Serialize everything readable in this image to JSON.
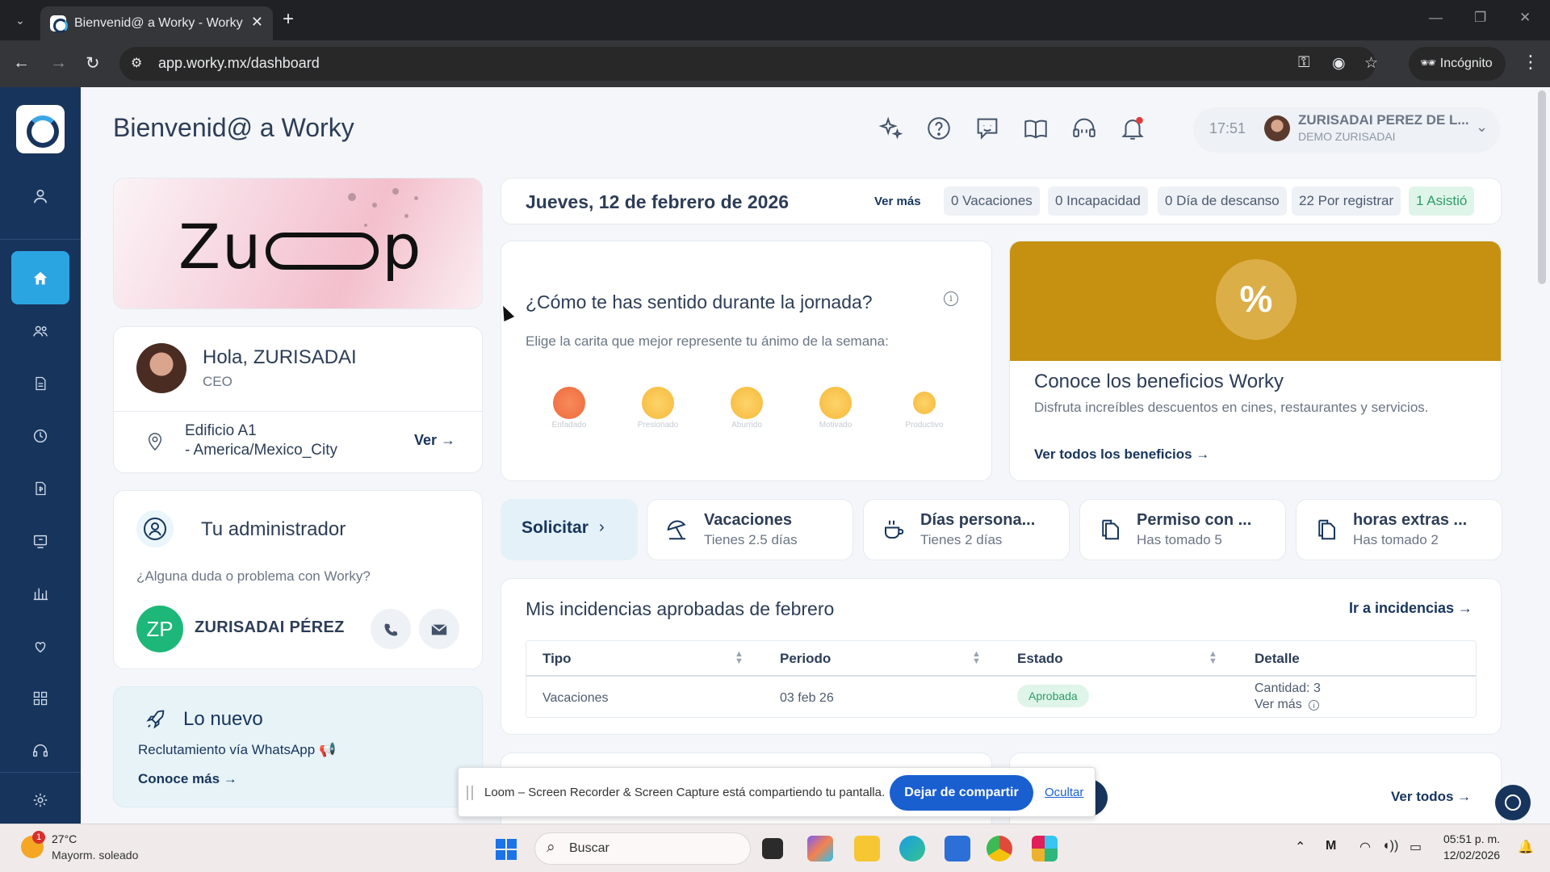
{
  "browser": {
    "tab_title": "Bienvenid@ a Worky - Worky R",
    "url": "app.worky.mx/dashboard",
    "incognito_label": "Incógnito"
  },
  "header": {
    "title": "Bienvenid@ a Worky",
    "time": "17:51",
    "user_name": "ZURISADAI PEREZ DE L...",
    "user_company": "DEMO ZURISADAI",
    "icons": [
      "sparkles-icon",
      "help-icon",
      "feedback-icon",
      "guide-book-icon",
      "support-headset-icon",
      "notifications-bell-icon"
    ]
  },
  "sidebar": {
    "items": [
      "profile",
      "home",
      "team",
      "documents",
      "attendance",
      "payroll",
      "recognition",
      "reports",
      "wellbeing",
      "apps",
      "support",
      "settings"
    ]
  },
  "banner": {
    "brand": "Zuup"
  },
  "profile": {
    "greeting": "Hola, ZURISADAI",
    "role": "CEO",
    "location_line1": "Edificio A1",
    "location_line2": "- America/Mexico_City",
    "view_label": "Ver →"
  },
  "admin": {
    "title": "Tu administrador",
    "question": "¿Alguna duda o problema con Worky?",
    "initials": "ZP",
    "name": "ZURISADAI PÉREZ"
  },
  "news": {
    "title": "Lo nuevo",
    "text": "Reclutamiento vía WhatsApp 📢",
    "link": "Conoce más   →"
  },
  "datebar": {
    "date": "Jueves, 12 de febrero de 2026",
    "more": "Ver más",
    "chips": [
      "0 Vacaciones",
      "0 Incapacidad",
      "0 Día de descanso",
      "22 Por registrar",
      "1 Asistió"
    ]
  },
  "mood": {
    "title": "¿Cómo te has sentido durante la jornada?",
    "subtitle": "Elige la carita que mejor represente tu ánimo de la semana:",
    "faces": [
      "Enfadado",
      "Presionado",
      "Aburrido",
      "Motivado",
      "Productivo"
    ]
  },
  "benefits": {
    "title": "Conoce los beneficios Worky",
    "subtitle": "Disfruta increíbles descuentos en cines, restaurantes y servicios.",
    "link": "Ver todos los beneficios →",
    "colors": {
      "banner": "#c69011"
    }
  },
  "requests": {
    "solicitar": "Solicitar",
    "cards": [
      {
        "title": "Vacaciones",
        "subtitle": "Tienes 2.5 días"
      },
      {
        "title": "Días persona...",
        "subtitle": "Tienes 2 días"
      },
      {
        "title": "Permiso con ...",
        "subtitle": "Has tomado 5"
      },
      {
        "title": "horas extras ...",
        "subtitle": "Has tomado 2"
      }
    ]
  },
  "incidents": {
    "title": "Mis incidencias aprobadas de febrero",
    "link": "Ir a incidencias →",
    "columns": [
      "Tipo",
      "Periodo",
      "Estado",
      "Detalle"
    ],
    "rows": [
      {
        "tipo": "Vacaciones",
        "periodo": "03 feb 26",
        "estado": "Aprobada",
        "cantidad": "Cantidad:  3",
        "ver_mas": "Ver más"
      }
    ]
  },
  "lower": {
    "ver_todos": "Ver todos  →"
  },
  "loom": {
    "message": "Loom – Screen Recorder & Screen Capture está compartiendo tu pantalla.",
    "stop": "Dejar de compartir",
    "hide": "Ocultar"
  },
  "taskbar": {
    "weather_badge": "1",
    "temperature": "27°C",
    "weather": "Mayorm. soleado",
    "search": "Buscar",
    "time": "05:51 p. m.",
    "date": "12/02/2026"
  }
}
